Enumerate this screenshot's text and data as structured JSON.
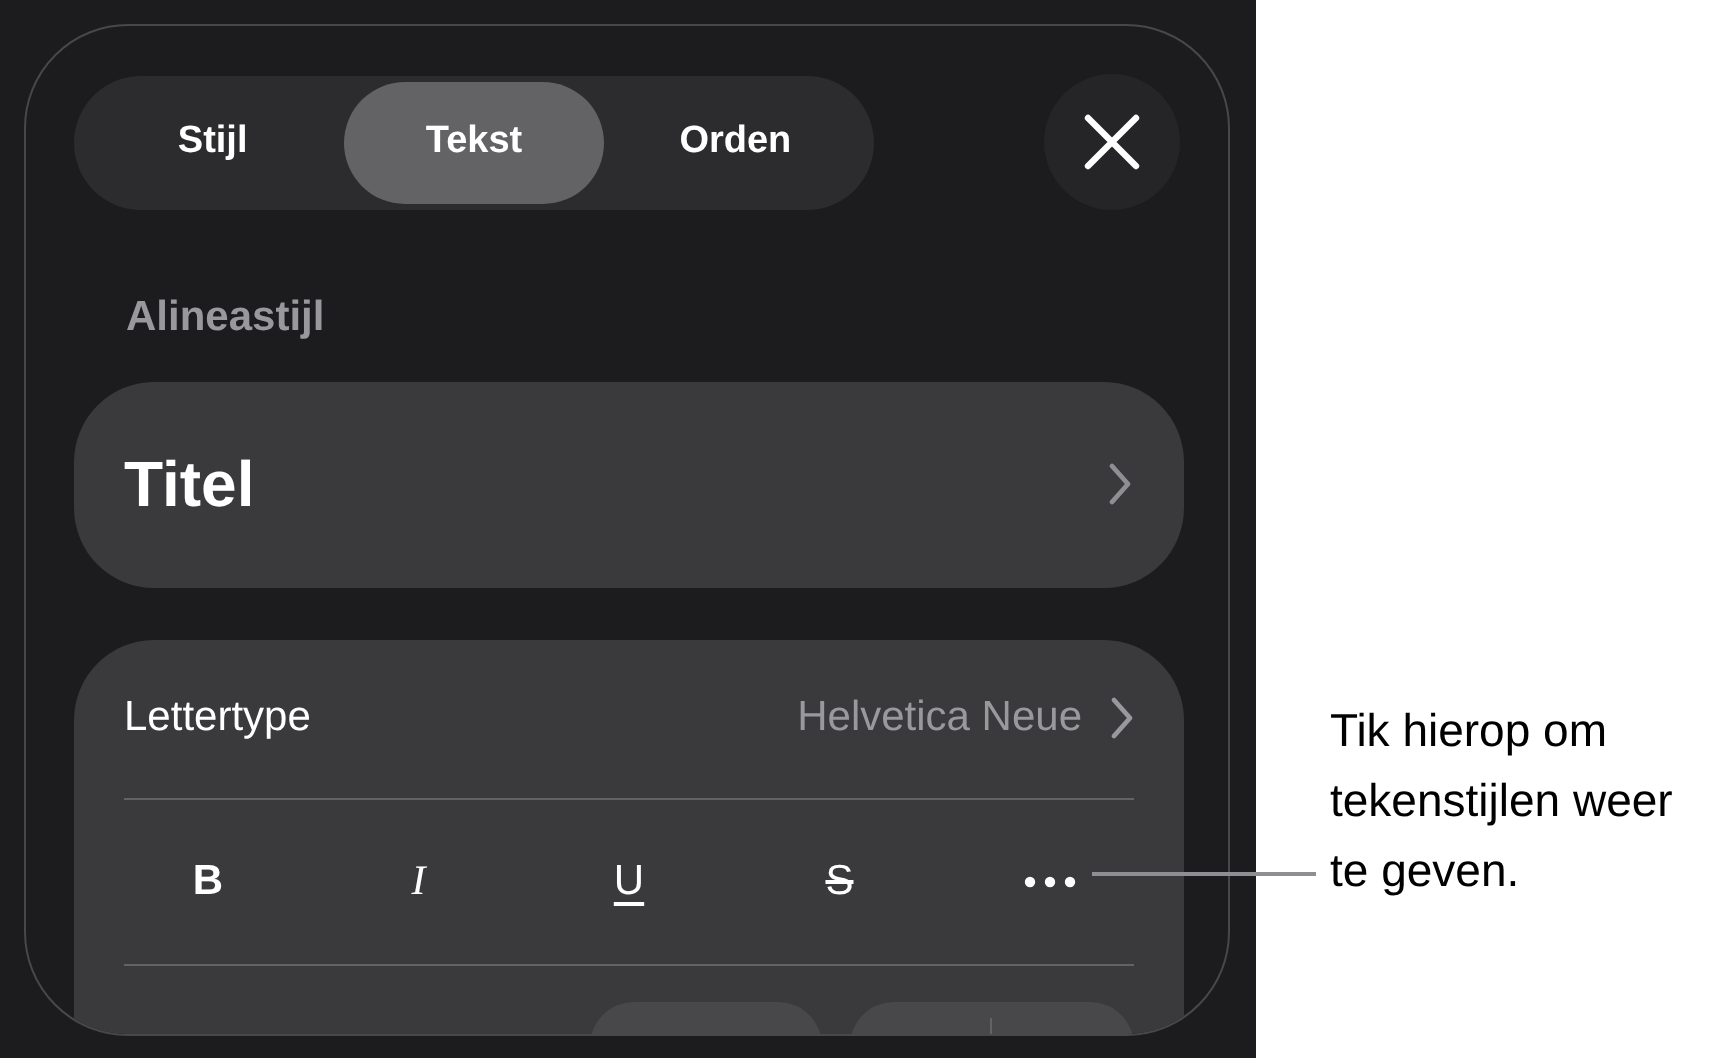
{
  "tabs": [
    {
      "label": "Stijl",
      "selected": false
    },
    {
      "label": "Tekst",
      "selected": true
    },
    {
      "label": "Orden",
      "selected": false
    }
  ],
  "paragraph_style": {
    "heading": "Alineastijl",
    "value": "Titel"
  },
  "font": {
    "label": "Lettertype",
    "value": "Helvetica Neue"
  },
  "format_buttons": [
    {
      "kind": "bold",
      "label": "B"
    },
    {
      "kind": "italic",
      "label": "I"
    },
    {
      "kind": "underline",
      "label": "U"
    },
    {
      "kind": "strikethrough",
      "label": "S"
    },
    {
      "kind": "more"
    }
  ],
  "callout": "Tik hierop om tekenstijlen weer te geven."
}
